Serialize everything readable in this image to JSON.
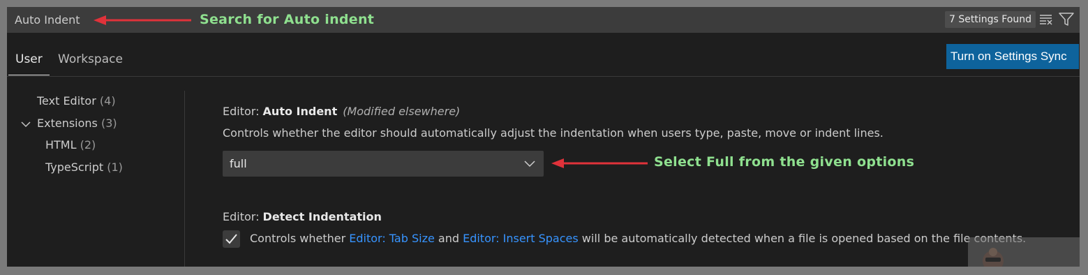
{
  "search": {
    "value": "Auto Indent"
  },
  "found": {
    "label": "7 Settings Found"
  },
  "annotations": {
    "search_note": "Search for Auto indent",
    "select_note": "Select Full from the given options",
    "arrow_color": "#e0323a",
    "text_color": "#8fe08f"
  },
  "tabs": [
    {
      "label": "User"
    },
    {
      "label": "Workspace"
    }
  ],
  "sync_button": {
    "label": "Turn on Settings Sync"
  },
  "toc": {
    "items": [
      {
        "label": "Text Editor",
        "count": "(4)"
      },
      {
        "label": "Extensions",
        "count": "(3)"
      },
      {
        "label": "HTML",
        "count": "(2)"
      },
      {
        "label": "TypeScript",
        "count": "(1)"
      }
    ]
  },
  "settings": {
    "auto_indent": {
      "category": "Editor: ",
      "name": "Auto Indent",
      "modified": "(Modified elsewhere)",
      "description": "Controls whether the editor should automatically adjust the indentation when users type, paste, move or indent lines.",
      "value": "full"
    },
    "detect_indentation": {
      "category": "Editor: ",
      "name": "Detect Indentation",
      "checked": true,
      "desc_pre": "Controls whether ",
      "link1": "Editor: Tab Size",
      "desc_mid": " and ",
      "link2": "Editor: Insert Spaces",
      "desc_post": " will be automatically detected when a file is opened based on the file contents."
    }
  },
  "colors": {
    "accent": "#0e639c",
    "link": "#3794ff",
    "background": "#1e1e1e"
  },
  "icons": [
    "clear-filter-icon",
    "filter-icon",
    "chevron-down-icon",
    "check-icon"
  ]
}
